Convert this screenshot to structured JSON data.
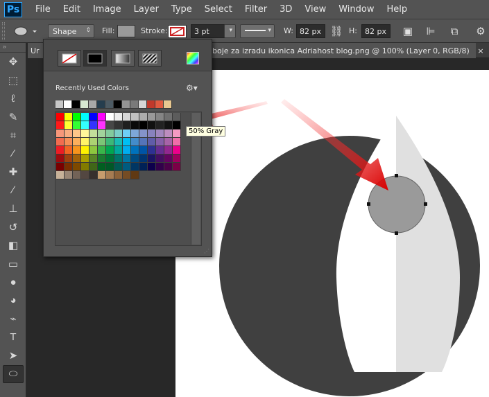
{
  "app": {
    "logo": "Ps"
  },
  "menu": [
    "File",
    "Edit",
    "Image",
    "Layer",
    "Type",
    "Select",
    "Filter",
    "3D",
    "View",
    "Window",
    "Help"
  ],
  "options": {
    "tool_mode": "Shape",
    "fill_label": "Fill:",
    "stroke_label": "Stroke:",
    "stroke_width": "3 pt",
    "w_label": "W:",
    "w_value": "82 px",
    "h_label": "H:",
    "h_value": "82 px",
    "fill_color": "#9a9a9a",
    "stroke_color": "#cc2020"
  },
  "tabs": [
    {
      "label": "Ur"
    },
    {
      "label": "boje za izradu ikonica Adriahost blog.png @ 100% (Layer 0, RGB/8)",
      "close": "×"
    }
  ],
  "popup": {
    "recent_label": "Recently Used Colors",
    "recent_colors": [
      "#c8c8c8",
      "#ffffff",
      "#000000",
      "#d7e8d2",
      "#a8a8a8",
      "#253d4e",
      "#4c5a63",
      "#000000",
      "#959595",
      "#7a7a7a",
      "#d6d6d6",
      "#c0392b",
      "#e05a40",
      "#e8c890"
    ],
    "swatch_rows": [
      [
        "#ff0000",
        "#ffff00",
        "#00ff00",
        "#00ffff",
        "#0000ff",
        "#ff00ff",
        "#ffffff",
        "#ebebeb",
        "#d6d6d6",
        "#c2c2c2",
        "#adadad",
        "#999999",
        "#858585",
        "#707070",
        "#5c5c5c"
      ],
      [
        "#ff1a1a",
        "#ffff33",
        "#33ff33",
        "#33ffff",
        "#3333ff",
        "#ff33ff",
        "#474747",
        "#333333",
        "#1f1f1f",
        "#0a0a0a",
        "#000000",
        "#111111",
        "#222222",
        "#121212",
        "#000000"
      ],
      [
        "#f7977a",
        "#f9ad81",
        "#fdc68a",
        "#fff79a",
        "#c4df9b",
        "#a2d39c",
        "#82ca9d",
        "#7bcdc8",
        "#6ecff6",
        "#7ea7d8",
        "#8493ca",
        "#8882be",
        "#a187be",
        "#bc8dbf",
        "#f49ac2"
      ],
      [
        "#f26c4f",
        "#f68e55",
        "#fbaf5c",
        "#fff467",
        "#acd372",
        "#7cc576",
        "#3bb878",
        "#1abbb4",
        "#00bff3",
        "#438cca",
        "#5574b9",
        "#605ca8",
        "#855fa8",
        "#a763a8",
        "#f06ea9"
      ],
      [
        "#ed1c24",
        "#f26522",
        "#f7941d",
        "#fff200",
        "#8dc73f",
        "#39b54a",
        "#00a651",
        "#00a99d",
        "#00aeef",
        "#0072bc",
        "#0054a6",
        "#2e3192",
        "#662d91",
        "#92278f",
        "#ec008c"
      ],
      [
        "#9e0b0f",
        "#a0410d",
        "#a36209",
        "#aba000",
        "#598527",
        "#1a7b30",
        "#007236",
        "#00746b",
        "#0076a3",
        "#004b80",
        "#003471",
        "#1b1464",
        "#440e62",
        "#630460",
        "#9e005d"
      ],
      [
        "#790000",
        "#7b2e00",
        "#7d4900",
        "#827b00",
        "#406618",
        "#005e20",
        "#005826",
        "#005952",
        "#005b7f",
        "#003663",
        "#002157",
        "#0d004c",
        "#32004b",
        "#4b0049",
        "#7b0046"
      ],
      [
        "#c7b299",
        "#998675",
        "#736357",
        "#534741",
        "#37302d",
        "#c69c6d",
        "#a67c52",
        "#8c6239",
        "#754c24",
        "#603913"
      ]
    ],
    "tooltip": "50% Gray"
  },
  "canvas": {
    "circle_color": "#404040",
    "shape_left_color": "#ffffff",
    "shape_right_color": "#e0e0e0",
    "small_circle_color": "#9a9a9a",
    "arrow_color": "#e01010"
  },
  "toolbar": {
    "tools": [
      "move-icon",
      "marquee-icon",
      "lasso-icon",
      "quick-select-icon",
      "crop-icon",
      "eyedropper-icon",
      "healing-icon",
      "brush-icon",
      "stamp-icon",
      "history-brush-icon",
      "eraser-icon",
      "gradient-icon",
      "blur-icon",
      "dodge-icon",
      "pen-icon",
      "type-icon",
      "path-select-icon",
      "ellipse-icon"
    ],
    "glyphs": [
      "✥",
      "⬚",
      "ℓ",
      "✎",
      "⌗",
      "⁄",
      "✚",
      "∕",
      "⊥",
      "↺",
      "◧",
      "▭",
      "●",
      "◕",
      "⌁",
      "T",
      "➤",
      "⬭"
    ]
  }
}
